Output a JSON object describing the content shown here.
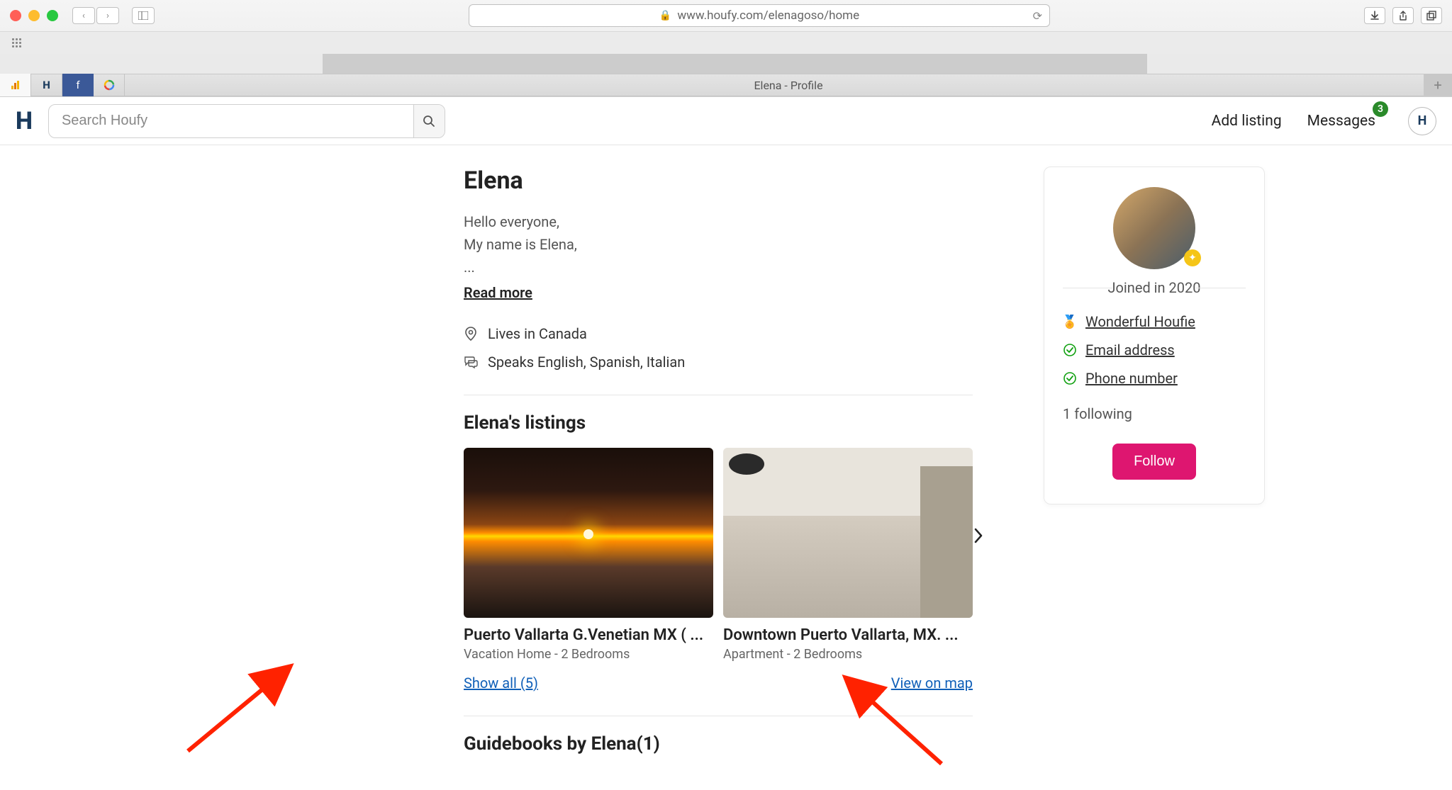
{
  "browser": {
    "url": "www.houfy.com/elenagoso/home",
    "tab_title": "Elena - Profile"
  },
  "header": {
    "logo": "H",
    "search_placeholder": "Search Houfy",
    "add_listing": "Add listing",
    "messages": "Messages",
    "messages_badge": "3",
    "avatar_letter": "H"
  },
  "profile": {
    "name": "Elena",
    "bio_line1": "Hello everyone,",
    "bio_line2": "My name is Elena,",
    "bio_line3": "...",
    "read_more": "Read more",
    "lives": "Lives in Canada",
    "speaks": "Speaks English, Spanish, Italian"
  },
  "listings": {
    "heading": "Elena's listings",
    "items": [
      {
        "title": "Puerto Vallarta G.Venetian MX ( ...",
        "subtitle": "Vacation Home - 2 Bedrooms"
      },
      {
        "title": "Downtown Puerto Vallarta, MX. ...",
        "subtitle": "Apartment - 2 Bedrooms"
      }
    ],
    "show_all": "Show all (5)",
    "view_on_map": "View on map"
  },
  "guidebooks": {
    "heading": "Guidebooks by Elena(1)"
  },
  "sidebar": {
    "joined": "Joined in 2020",
    "wonderful": "Wonderful Houfie",
    "email": "Email address",
    "phone": "Phone number",
    "following": "1 following",
    "follow_btn": "Follow"
  }
}
